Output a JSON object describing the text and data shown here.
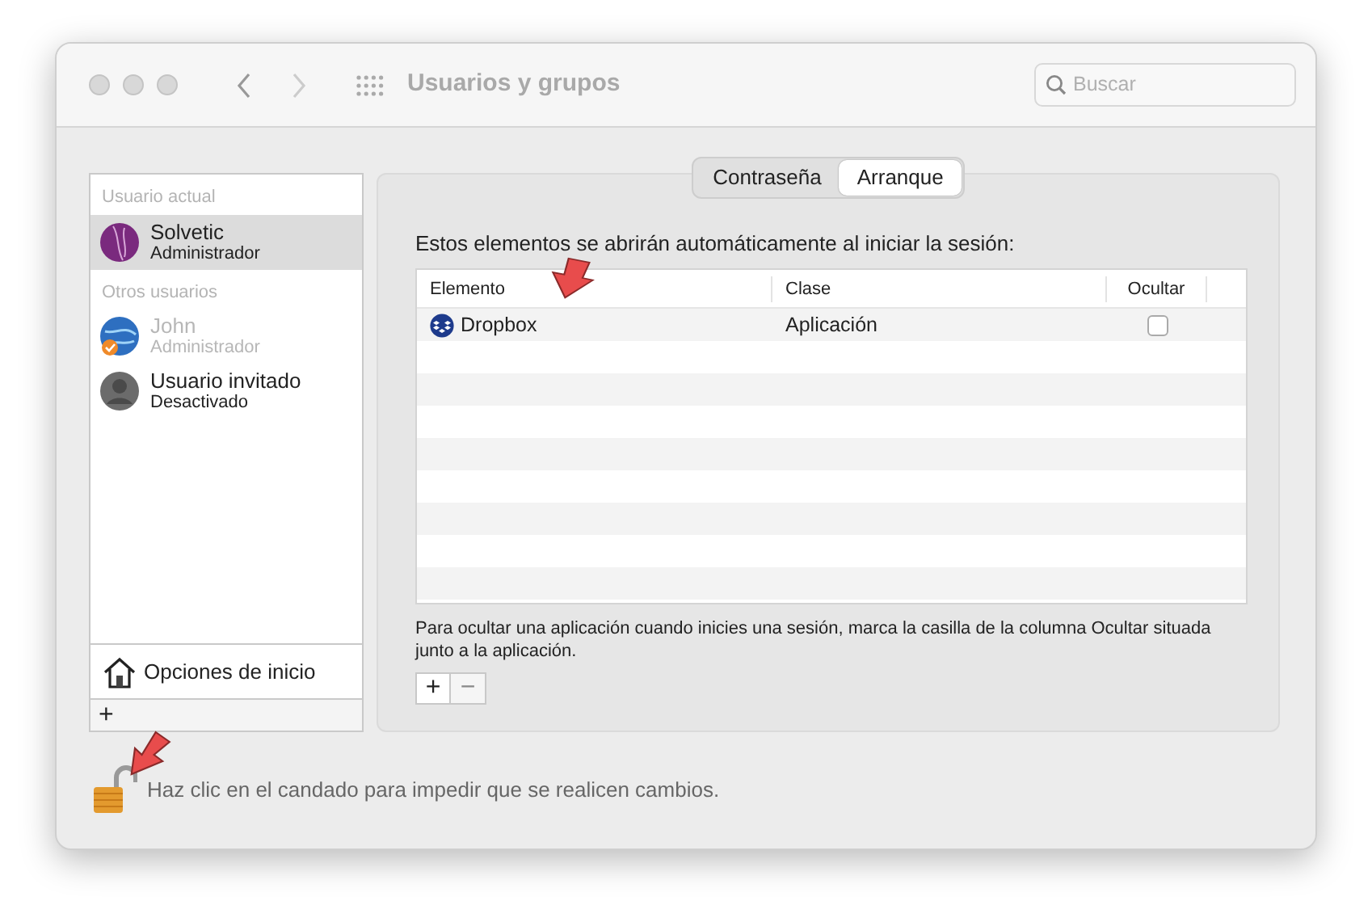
{
  "window": {
    "title": "Usuarios y grupos",
    "search": {
      "placeholder": "Buscar"
    }
  },
  "sidebar": {
    "sections": [
      {
        "header": "Usuario actual",
        "users": [
          {
            "name": "Solvetic",
            "role": "Administrador",
            "selected": true,
            "disabled": false,
            "kind": "violet"
          }
        ]
      },
      {
        "header": "Otros usuarios",
        "users": [
          {
            "name": "John",
            "role": "Administrador",
            "selected": false,
            "disabled": true,
            "kind": "globe"
          },
          {
            "name": "Usuario invitado",
            "role": "Desactivado",
            "selected": false,
            "disabled": false,
            "kind": "guest"
          }
        ]
      }
    ],
    "login_options": "Opciones de inicio",
    "add_button": "+"
  },
  "tabs": [
    {
      "label": "Contraseña",
      "selected": false
    },
    {
      "label": "Arranque",
      "selected": true
    }
  ],
  "intro": "Estos elementos se abrirán automáticamente al iniciar la sesión:",
  "table": {
    "columns": [
      "Elemento",
      "Clase",
      "Ocultar"
    ],
    "rows": [
      {
        "element": "Dropbox",
        "class": "Aplicación",
        "hidden": false
      }
    ]
  },
  "hint": "Para ocultar una aplicación cuando inicies una sesión, marca la casilla de la columna Ocultar situada junto a la aplicación.",
  "list_buttons": [
    {
      "label": "+",
      "disabled": false
    },
    {
      "label": "−",
      "disabled": true
    }
  ],
  "lock": {
    "text": "Haz clic en el candado para impedir que se realicen cambios.",
    "locked": false
  }
}
